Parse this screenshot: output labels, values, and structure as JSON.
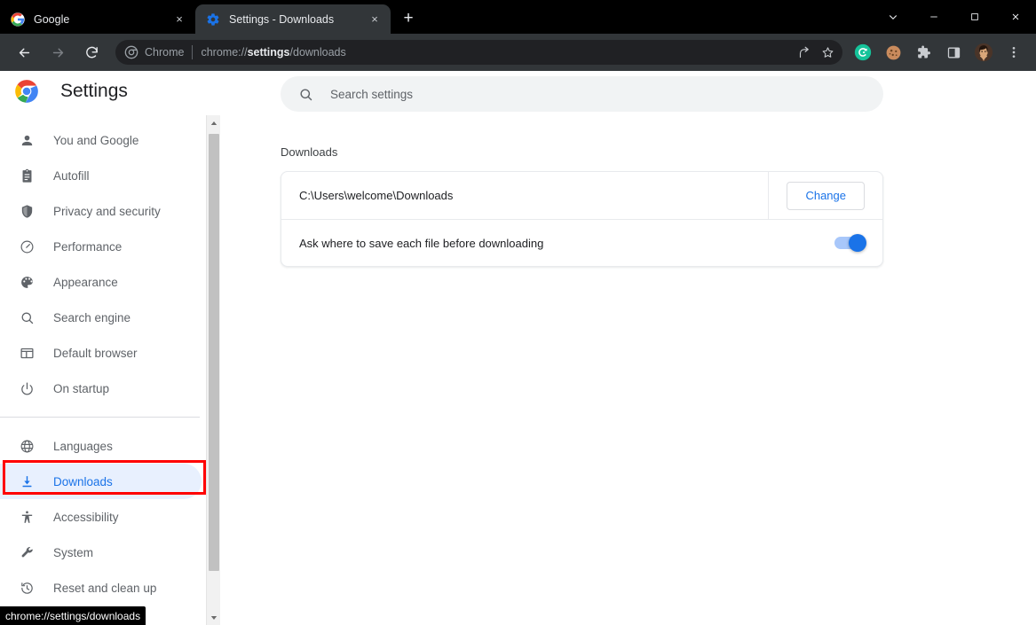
{
  "window": {
    "controls": [
      {
        "name": "tab-search-button",
        "glyph": "chevron-down-icon"
      },
      {
        "name": "minimize-button",
        "glyph": "minimize-icon"
      },
      {
        "name": "maximize-button",
        "glyph": "maximize-icon"
      },
      {
        "name": "close-button",
        "glyph": "close-icon"
      }
    ]
  },
  "tabs": [
    {
      "title": "Google",
      "favicon": "google-g-icon",
      "active": false,
      "close": "×"
    },
    {
      "title": "Settings - Downloads",
      "favicon": "gear-icon",
      "active": true,
      "close": "×"
    }
  ],
  "newtab_label": "+",
  "toolbar": {
    "back_label": "←",
    "forward_label": "→",
    "reload_label": "↻",
    "omnibox": {
      "chrome_label": "Chrome",
      "url_prefix": "chrome://",
      "url_bold": "settings",
      "url_suffix": "/downloads",
      "full_url": "chrome://settings/downloads"
    },
    "actions": [
      {
        "name": "share-icon"
      },
      {
        "name": "bookmark-star-icon"
      }
    ],
    "extensions": [
      {
        "name": "grammarly-icon",
        "color": "#15c39a",
        "letter": "G"
      },
      {
        "name": "cookie-icon",
        "color": "#c98b5d"
      },
      {
        "name": "puzzle-extensions-icon",
        "color": "#c9ccd0"
      },
      {
        "name": "side-panel-icon",
        "color": "#c9ccd0"
      },
      {
        "name": "profile-avatar",
        "color": "#8a6a52"
      },
      {
        "name": "chrome-menu-icon",
        "color": "#c9ccd0"
      }
    ]
  },
  "settings": {
    "app_title": "Settings",
    "logo": "chrome-logo-icon",
    "search": {
      "placeholder": "Search settings",
      "value": "",
      "icon": "search-icon"
    },
    "sidebar": {
      "groups": [
        {
          "items": [
            {
              "label": "You and Google",
              "icon": "person-icon",
              "selected": false
            },
            {
              "label": "Autofill",
              "icon": "clipboard-icon",
              "selected": false
            },
            {
              "label": "Privacy and security",
              "icon": "shield-icon",
              "selected": false
            },
            {
              "label": "Performance",
              "icon": "speedometer-icon",
              "selected": false
            },
            {
              "label": "Appearance",
              "icon": "palette-icon",
              "selected": false
            },
            {
              "label": "Search engine",
              "icon": "search-icon",
              "selected": false
            },
            {
              "label": "Default browser",
              "icon": "browser-window-icon",
              "selected": false
            },
            {
              "label": "On startup",
              "icon": "power-icon",
              "selected": false
            }
          ]
        },
        {
          "items": [
            {
              "label": "Languages",
              "icon": "globe-icon",
              "selected": false
            },
            {
              "label": "Downloads",
              "icon": "download-icon",
              "selected": true
            },
            {
              "label": "Accessibility",
              "icon": "accessibility-icon",
              "selected": false
            },
            {
              "label": "System",
              "icon": "wrench-icon",
              "selected": false
            },
            {
              "label": "Reset and clean up",
              "icon": "history-restore-icon",
              "selected": false
            }
          ]
        }
      ]
    },
    "main": {
      "section_title": "Downloads",
      "location_row": {
        "path": "C:\\Users\\welcome\\Downloads",
        "change_label": "Change"
      },
      "ask_row": {
        "label": "Ask where to save each file before downloading",
        "toggle_on": true
      }
    }
  },
  "status_bubble": {
    "text": "chrome://settings/downloads"
  },
  "colors": {
    "accent_blue": "#1a73e8",
    "selected_bg": "#e8f0fe",
    "toggle_track": "#a8c7fa",
    "annotation_red": "#ff0000",
    "toolbar_bg": "#323639",
    "omnibox_bg": "#202124",
    "search_bg": "#f1f3f4"
  }
}
